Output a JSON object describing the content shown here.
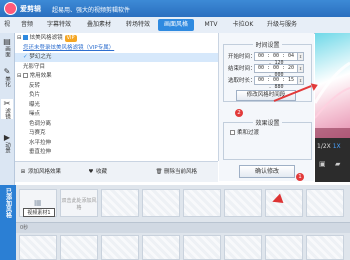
{
  "app": {
    "name": "爱剪辑",
    "tagline": "超易用、强大的视频剪辑软件"
  },
  "tabs": [
    {
      "label": "视",
      "active": false
    },
    {
      "label": "音频",
      "active": false
    },
    {
      "label": "字幕特效",
      "active": false
    },
    {
      "label": "叠加素材",
      "active": false
    },
    {
      "label": "转场特效",
      "active": false
    },
    {
      "label": "画面风格",
      "active": true
    },
    {
      "label": "MTV",
      "active": false
    },
    {
      "label": "卡拉OK",
      "active": false
    },
    {
      "label": "升级与服务",
      "active": false
    }
  ],
  "left_nav": [
    {
      "icon": "▤",
      "label": "画面",
      "active": false
    },
    {
      "icon": "✎",
      "label": "美化",
      "active": false
    },
    {
      "icon": "✂",
      "label": "滤镜",
      "active": true
    },
    {
      "icon": "▶",
      "label": "动景",
      "active": false
    }
  ],
  "effects_tree": {
    "vip_badge": "VIP",
    "rows": [
      {
        "text": "炫美风格滤镜",
        "indent": 2,
        "checkbox": true,
        "checked": true,
        "expander": "⊟",
        "vip": true,
        "type": "group"
      },
      {
        "text": "您还未登录炫美风格滤镜（VIP专属）",
        "indent": 8,
        "type": "hint"
      },
      {
        "text": "梦幻之光",
        "indent": 8,
        "type": "item",
        "selected": true,
        "mark": "✓"
      },
      {
        "text": "光影守目",
        "indent": 8,
        "type": "item"
      },
      {
        "text": "常用效果",
        "indent": 2,
        "checkbox": true,
        "expander": "⊟",
        "type": "group"
      },
      {
        "text": "反转",
        "indent": 14,
        "type": "item"
      },
      {
        "text": "负片",
        "indent": 14,
        "type": "item"
      },
      {
        "text": "曝光",
        "indent": 14,
        "type": "item"
      },
      {
        "text": "噪点",
        "indent": 14,
        "type": "item"
      },
      {
        "text": "色调分离",
        "indent": 14,
        "type": "item"
      },
      {
        "text": "马赛克",
        "indent": 14,
        "type": "item"
      },
      {
        "text": "水平拉伸",
        "indent": 14,
        "type": "item"
      },
      {
        "text": "垂直拉伸",
        "indent": 14,
        "type": "item"
      }
    ]
  },
  "effects_toolbar": {
    "add_label": "添加风格效果",
    "favorite_label": "收藏",
    "delete_label": "删除当前风格"
  },
  "time_settings": {
    "title": "时间设置",
    "start_label": "开始时间：",
    "start_value": "00 : 00 : 04 . 120",
    "end_label": "结束时间：",
    "end_value": "00 : 00 : 20 . 000",
    "duration_label": "选取时长：",
    "duration_value": "00 : 00 : 15 . 880",
    "adjust_label": "修改风格时间段"
  },
  "special_settings": {
    "title": "效果设置",
    "option_label": "柔和过渡"
  },
  "confirm_label": "确认修改",
  "preview": {
    "speed_label": "1/2X",
    "speed_active": "1X"
  },
  "annotations": {
    "step_1": "1",
    "step_2": "2"
  },
  "timeline": {
    "header": "已添加风格",
    "frames": [
      {
        "label": "视频素材1",
        "type": "boxed"
      },
      {
        "label": "双击此处添加风格",
        "type": "ghost"
      },
      {
        "label": "",
        "type": "blank"
      },
      {
        "label": "",
        "type": "blank"
      },
      {
        "label": "",
        "type": "blank"
      },
      {
        "label": "",
        "type": "blank"
      },
      {
        "label": "",
        "type": "blank"
      },
      {
        "label": "",
        "type": "blank"
      }
    ],
    "ruler_label": "0秒"
  },
  "colors": {
    "accent": "#2f8ae0",
    "annotation": "#e23a3a",
    "titlebar": "#2a6fbf"
  }
}
